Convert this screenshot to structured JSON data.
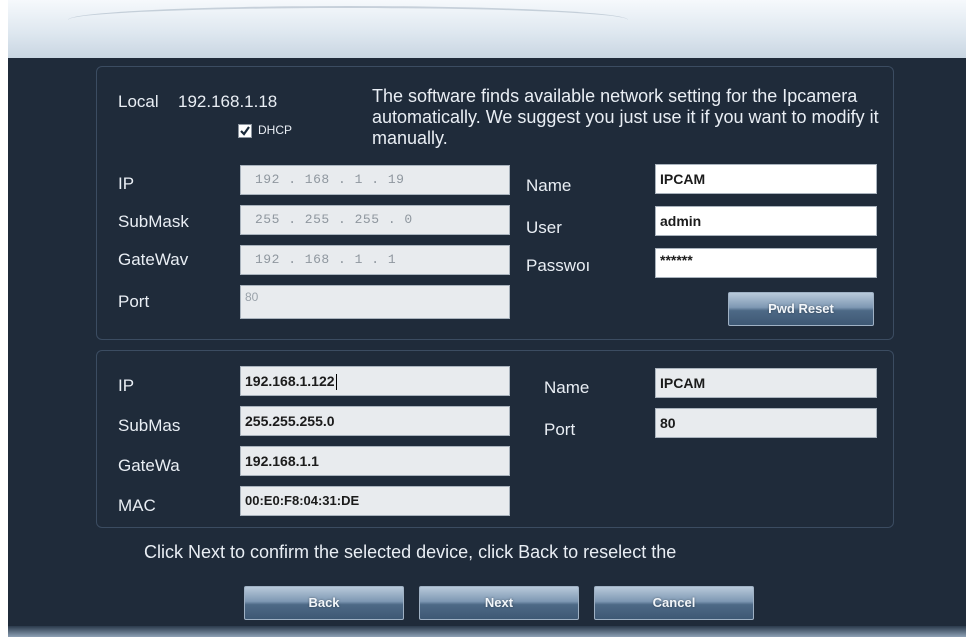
{
  "local": {
    "label": "Local",
    "ip": "192.168.1.18"
  },
  "dhcp": {
    "label": "DHCP",
    "checked": true
  },
  "info_text": "The software finds available network setting for the Ipcamera automatically. We suggest you just use it if you want to modify it manually.",
  "local_settings": {
    "ip": {
      "label": "IP",
      "value": "192 . 168 . 1 . 19"
    },
    "submask": {
      "label": "SubMask",
      "value": "255 . 255 . 255 . 0"
    },
    "gateway": {
      "label": "GateWav",
      "value": "192 . 168 . 1 . 1"
    },
    "port": {
      "label": "Port",
      "value": "80"
    },
    "name": {
      "label": "Name",
      "value": "IPCAM"
    },
    "user": {
      "label": "User",
      "value": "admin"
    },
    "password": {
      "label": "Passwoı",
      "value": "******"
    },
    "pwd_reset": "Pwd Reset"
  },
  "device": {
    "ip": {
      "label": "IP",
      "value": "192.168.1.122"
    },
    "submask": {
      "label": "SubMas",
      "value": "255.255.255.0"
    },
    "gateway": {
      "label": "GateWa",
      "value": "192.168.1.1"
    },
    "mac": {
      "label": "MAC",
      "value": "00:E0:F8:04:31:DE"
    },
    "name": {
      "label": "Name",
      "value": "IPCAM"
    },
    "port": {
      "label": "Port",
      "value": "80"
    }
  },
  "footer_text": "Click Next to confirm the selected device, click Back to reselect the",
  "buttons": {
    "back": "Back",
    "next": "Next",
    "cancel": "Cancel"
  },
  "colors": {
    "background": "#1f2b3a",
    "panel_border": "#3b4c61",
    "field": "#e8ebee",
    "button": "#4d6986"
  }
}
